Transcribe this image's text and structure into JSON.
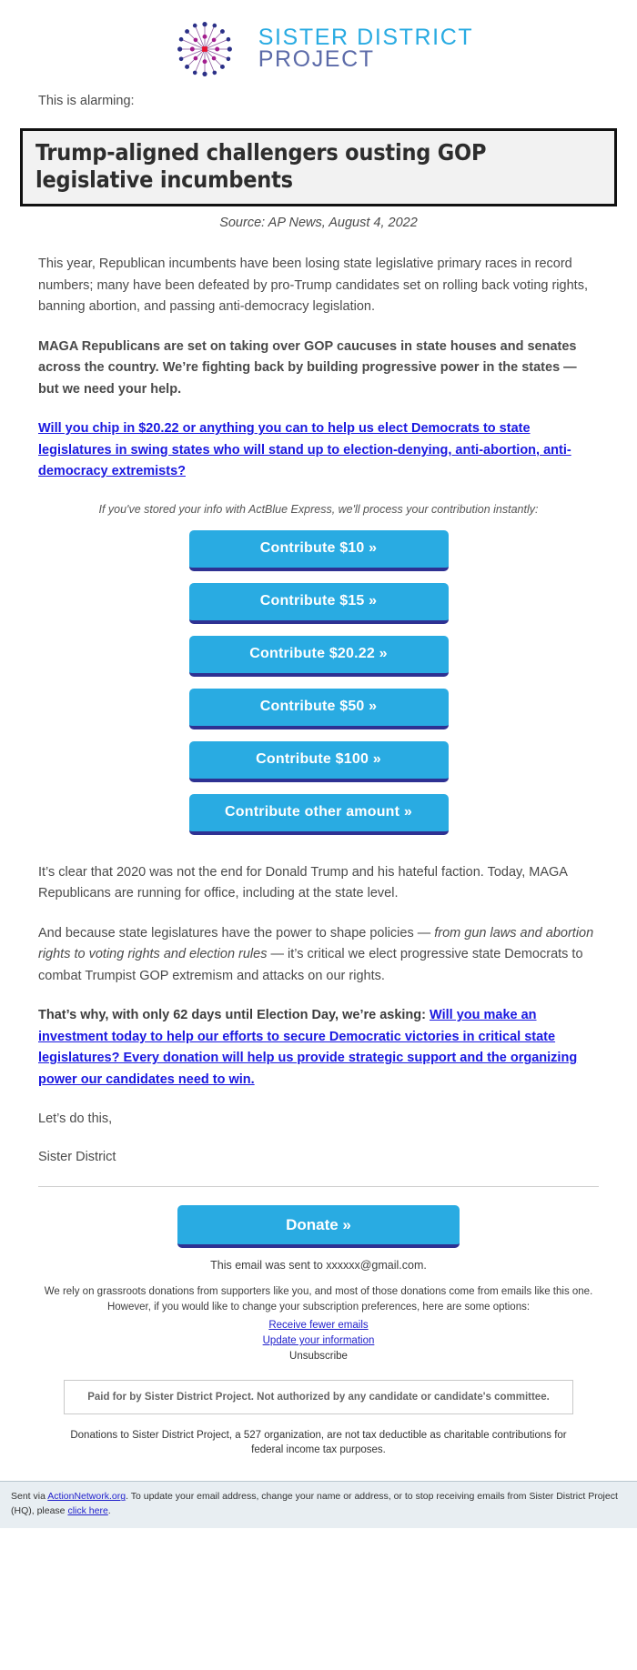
{
  "brand": {
    "name_line1": "SISTER DISTRICT",
    "name_line2": "PROJECT",
    "accent_cyan": "#29ABE2",
    "accent_navy": "#2E3192",
    "accent_magenta": "#A31E8E",
    "accent_red": "#E8112D",
    "link_blue": "#1A18E0"
  },
  "intro": "This is alarming:",
  "headline": "Trump-aligned challengers ousting GOP legislative incumbents",
  "source": "Source: AP News, August 4, 2022",
  "para1": "This year, Republican incumbents have been losing state legislative primary races in record numbers; many have been defeated by pro-Trump candidates set on rolling back voting rights, banning abortion, and passing anti-democracy legislation.",
  "para2_bold": "MAGA Republicans are set on taking over GOP caucuses in state houses and senates across the country. We’re fighting back by building progressive power in the states — but we need your help.",
  "ask_link": "Will you chip in $20.22 or anything you can to help us elect Democrats to state legislatures in swing states who will stand up to election-denying, anti-abortion, anti-democracy extremists?",
  "express_note": "If you've stored your info with ActBlue Express, we'll process your contribution instantly:",
  "buttons": [
    {
      "label": "Contribute $10 »"
    },
    {
      "label": "Contribute $15 »"
    },
    {
      "label": "Contribute $20.22 »"
    },
    {
      "label": "Contribute $50 »"
    },
    {
      "label": "Contribute $100 »"
    },
    {
      "label": "Contribute other amount »"
    }
  ],
  "para3": "It’s clear that 2020 was not the end for Donald Trump and his hateful faction. Today, MAGA Republicans are running for office, including at the state level.",
  "para4_a": "And because state legislatures have the power to shape policies — ",
  "para4_ital": "from gun laws and abortion rights to voting rights and election rules",
  "para4_b": " — it’s critical we elect progressive state Democrats to combat Trumpist GOP extremism and attacks on our rights.",
  "para5_bold": "That’s why, with only 62 days until Election Day, we’re asking: ",
  "para5_link": "Will you make an investment today to help our efforts to secure Democratic victories in critical state legislatures? Every donation will help us provide strategic support and the organizing power our candidates need to win.",
  "signoff1": "Let’s do this,",
  "signoff2": "Sister District",
  "donate_label": "Donate »",
  "footer": {
    "sent_to": "This email was sent to xxxxxx@gmail.com.",
    "grassroots": "We rely on grassroots donations from supporters like you, and most of those donations come from emails like this one. However, if you would like to change your subscription preferences, here are some options:",
    "opt_fewer": "Receive fewer emails",
    "opt_update": "Update your information",
    "opt_unsub": "Unsubscribe",
    "paid_for": "Paid for by Sister District Project. Not authorized by any candidate or candidate's committee.",
    "deductible": "Donations to Sister District Project, a 527 organization, are not tax deductible as charitable contributions for federal income tax purposes.",
    "sent_via_pre": "Sent via ",
    "sent_via_link": "ActionNetwork.org",
    "sent_via_mid": ". To update your email address, change your name or address, or to stop receiving emails from Sister District Project (HQ), please ",
    "sent_via_link2": "click here",
    "sent_via_end": "."
  }
}
